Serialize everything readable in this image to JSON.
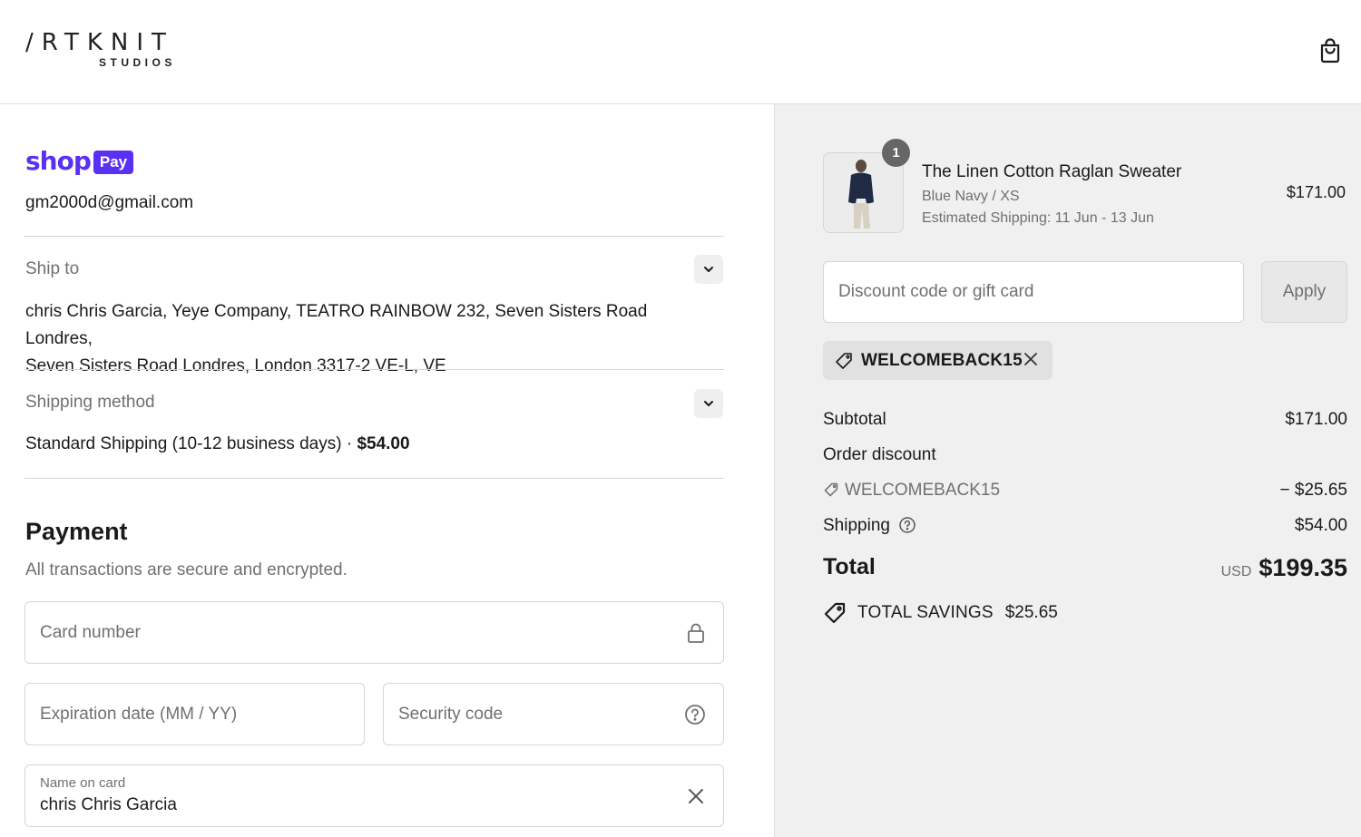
{
  "header": {
    "logo_main": "/RTKNIT",
    "logo_sub": "STUDIOS",
    "cart_icon": "shopping-bag-icon"
  },
  "express": {
    "shop_word": "shop",
    "shop_pill": "Pay",
    "email": "gm2000d@gmail.com",
    "brand_color": "#5a31f4"
  },
  "ship_to": {
    "label": "Ship to",
    "address_line1": "chris Chris Garcia, Yeye Company, TEATRO RAINBOW 232, Seven Sisters Road Londres,",
    "address_line2": "Seven Sisters Road Londres, London 3317-2 VE-L, VE",
    "toggle_icon": "chevron-down-icon"
  },
  "shipping_method": {
    "label": "Shipping method",
    "name": "Standard Shipping (10-12 business days) · ",
    "price": "$54.00",
    "toggle_icon": "chevron-down-icon"
  },
  "payment": {
    "title": "Payment",
    "subtitle": "All transactions are secure and encrypted.",
    "card_number_placeholder": "Card number",
    "expiry_placeholder": "Expiration date (MM / YY)",
    "security_placeholder": "Security code",
    "name_label": "Name on card",
    "name_value": "chris Chris Garcia"
  },
  "cart": {
    "item": {
      "quantity": "1",
      "name": "The Linen Cotton Raglan Sweater",
      "variant": "Blue Navy / XS",
      "shipping_estimate": "Estimated Shipping: 11 Jun - 13 Jun",
      "price": "$171.00"
    },
    "discount_placeholder": "Discount code or gift card",
    "apply_label": "Apply",
    "applied_code": "WELCOMEBACK15"
  },
  "summary": {
    "subtotal_label": "Subtotal",
    "subtotal_value": "$171.00",
    "order_discount_label": "Order discount",
    "discount_code": "WELCOMEBACK15",
    "discount_value": "− $25.65",
    "shipping_label": "Shipping",
    "shipping_value": "$54.00",
    "total_label": "Total",
    "currency": "USD",
    "total_value": "$199.35",
    "savings_label": "TOTAL SAVINGS",
    "savings_value": "$25.65"
  }
}
